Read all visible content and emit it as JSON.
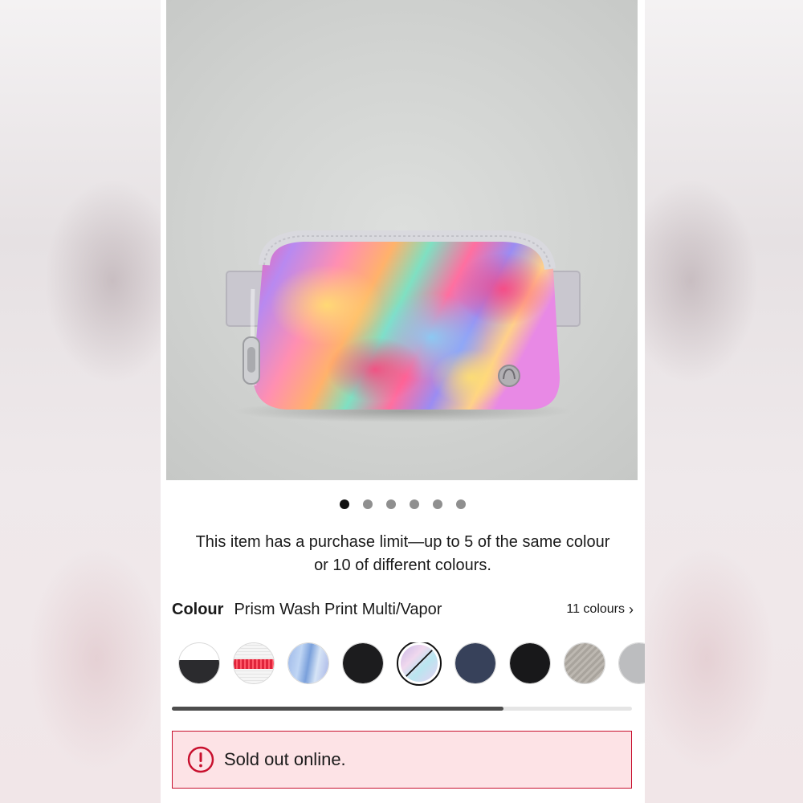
{
  "carousel": {
    "total": 6,
    "active_index": 0
  },
  "notice": {
    "line1": "This item has a purchase limit—up to 5 of the same colour",
    "line2": "or 10 of different colours."
  },
  "colour": {
    "label": "Colour",
    "name": "Prism Wash Print Multi/Vapor",
    "count": "11 colours",
    "chevron": "›"
  },
  "swatches": [
    {
      "name": "white-black",
      "selected": false
    },
    {
      "name": "white-red-stripe",
      "selected": false
    },
    {
      "name": "iridescent-blue",
      "selected": false
    },
    {
      "name": "black",
      "selected": false
    },
    {
      "name": "prism-wash-print-multi-vapor",
      "selected": true,
      "sold_out": true
    },
    {
      "name": "navy",
      "selected": false
    },
    {
      "name": "black-2",
      "selected": false
    },
    {
      "name": "grey-texture",
      "selected": false
    },
    {
      "name": "light-grey",
      "selected": false
    }
  ],
  "scroll": {
    "progress": 0.72
  },
  "alert": {
    "text": "Sold out online.",
    "icon": "alert-circle-icon",
    "color": "#c8102e"
  },
  "accent_colors": {
    "alert_border": "#c8102e",
    "alert_bg": "#fde3e6"
  }
}
